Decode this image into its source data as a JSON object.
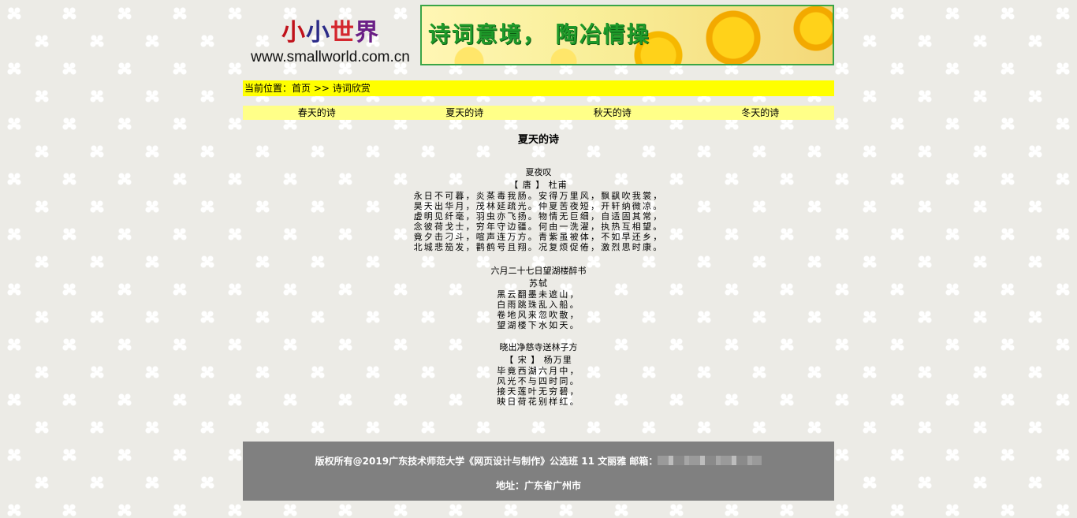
{
  "header": {
    "logo_title_chars": [
      "小",
      "小",
      "世",
      "界"
    ],
    "logo_url": "www.smallworld.com.cn",
    "banner_text": "诗词意境，  陶冶情操"
  },
  "breadcrumb": {
    "prefix": "当前位置：",
    "home": "首页",
    "separator": " >> ",
    "current": "诗词欣赏"
  },
  "nav": {
    "items": [
      "春天的诗",
      "夏天的诗",
      "秋天的诗",
      "冬天的诗"
    ]
  },
  "section_title": "夏天的诗",
  "poems": [
    {
      "title": "夏夜叹",
      "author": "【 唐 】 杜甫",
      "lines": [
        "永日不可暮，炎蒸毒我肠。安得万里风，飘飖吹我裳，",
        "昊天出华月，茂林延疏光。仲夏苦夜短，开轩纳微凉。",
        "虚明见纤毫，羽虫亦飞扬。物情无巨细，自适固其常，",
        "念彼荷戈士，穷年守边疆。何由一洗濯，执热互相望。",
        "竟夕击刁斗，喧声连万方。青紫虽被体，不如早还乡，",
        "北城悲笳发，鹳鹤号且翔。况复烦促倦，激烈思时康。"
      ]
    },
    {
      "title": "六月二十七日望湖楼醉书",
      "author": "苏轼",
      "lines": [
        "黑云翻墨未遮山，",
        "白雨跳珠乱入船。",
        "卷地风来忽吹散，",
        "望湖楼下水如天。"
      ]
    },
    {
      "title": "晓出净慈寺送林子方",
      "author": "【 宋 】 杨万里",
      "lines": [
        "毕竟西湖六月中，",
        "风光不与四时同。",
        "接天莲叶无穷碧，",
        "映日荷花别样红。"
      ]
    }
  ],
  "footer": {
    "copyright": "版权所有@2019广东技术师范大学《网页设计与制作》公选班 11 文丽雅 邮箱：",
    "address": "地址：广东省广州市"
  },
  "colors": {
    "breadcrumb_bg": "#ffff00",
    "nav_bg": "#ffff88",
    "footer_bg": "#808080",
    "banner_text": "#1f9a2a"
  }
}
